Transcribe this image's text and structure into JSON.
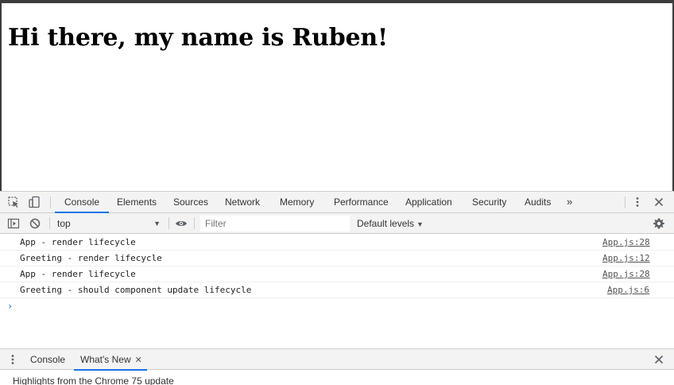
{
  "page": {
    "heading": "Hi there, my name is Ruben!"
  },
  "devtools": {
    "tabs": [
      {
        "label": "Console",
        "active": true
      },
      {
        "label": "Elements"
      },
      {
        "label": "Sources"
      },
      {
        "label": "Network"
      },
      {
        "label": "Memory"
      },
      {
        "label": "Performance"
      },
      {
        "label": "Application"
      },
      {
        "label": "Security"
      },
      {
        "label": "Audits"
      }
    ],
    "more_tabs_glyph": "»",
    "toolbar": {
      "context": "top",
      "filter_placeholder": "Filter",
      "levels": "Default levels",
      "levels_arrow": "▼",
      "context_arrow": "▼"
    },
    "console_messages": [
      {
        "text": "App - render lifecycle",
        "source": "App.js:28"
      },
      {
        "text": "Greeting - render lifecycle",
        "source": "App.js:12"
      },
      {
        "text": "App - render lifecycle",
        "source": "App.js:28"
      },
      {
        "text": "Greeting - should component update lifecycle",
        "source": "App.js:6"
      }
    ],
    "prompt_glyph": "›",
    "drawer": {
      "tabs": [
        {
          "label": "Console"
        },
        {
          "label": "What's New",
          "active": true,
          "close": "✕"
        }
      ],
      "whats_new_text": "Highlights from the Chrome 75 update"
    }
  },
  "colors": {
    "accent": "#1a73e8",
    "toolbar_bg": "#f3f3f3",
    "border": "#cbcdd1",
    "icon": "#5f6368"
  },
  "icons": [
    "inspect-element-icon",
    "device-toolbar-icon",
    "more-options-icon",
    "close-icon",
    "sidebar-toggle-icon",
    "clear-console-icon",
    "eye-icon",
    "gear-icon",
    "drawer-menu-icon",
    "drawer-close-icon"
  ]
}
